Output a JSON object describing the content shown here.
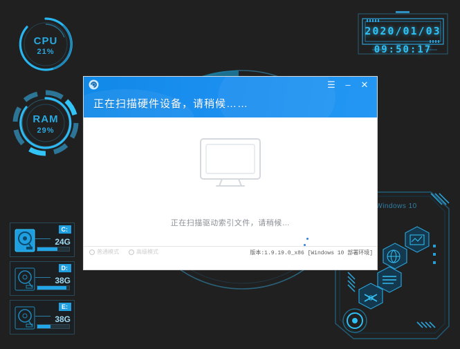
{
  "desktop": {
    "background_color": "#202020",
    "accent_color": "#1f9fe0"
  },
  "gauges": [
    {
      "id": "cpu",
      "name": "CPU",
      "value_label": "21%",
      "value": 21,
      "color": "#29b6f0"
    },
    {
      "id": "ram",
      "name": "RAM",
      "value_label": "29%",
      "value": 29,
      "color": "#29b6f0"
    }
  ],
  "clock": {
    "date": "2020/01/03",
    "time": "09:50:17",
    "color": "#2fc0f5"
  },
  "disks": [
    {
      "letter": "C:",
      "size": "24G",
      "used_percent": 62,
      "active": true
    },
    {
      "letter": "D:",
      "size": "38G",
      "used_percent": 92,
      "active": false
    },
    {
      "letter": "E:",
      "size": "38G",
      "used_percent": 42,
      "active": false
    }
  ],
  "right_panel": {
    "os_label": "Windows 10",
    "hex_tiles": [
      {
        "name": "network-icon"
      },
      {
        "name": "globe-icon"
      },
      {
        "name": "list-icon"
      },
      {
        "name": "tools-icon"
      }
    ]
  },
  "dialog": {
    "app_icon": "app-icon",
    "title": "正在扫描硬件设备，请稍候……",
    "window_buttons": [
      {
        "name": "menu-button",
        "glyph": "☰"
      },
      {
        "name": "minimize-button",
        "glyph": "–"
      },
      {
        "name": "close-button",
        "glyph": "✕"
      }
    ],
    "body": {
      "illustration": "monitor-icon",
      "status_text": "正在扫描驱动索引文件，请稍候…",
      "loading": "loading-dots"
    },
    "footer": {
      "modes": [
        {
          "label": "普通模式",
          "selected": false
        },
        {
          "label": "高级模式",
          "selected": false
        }
      ],
      "version": "版本:1.9.19.0_x86 [Windows 10 部署环境]"
    }
  }
}
